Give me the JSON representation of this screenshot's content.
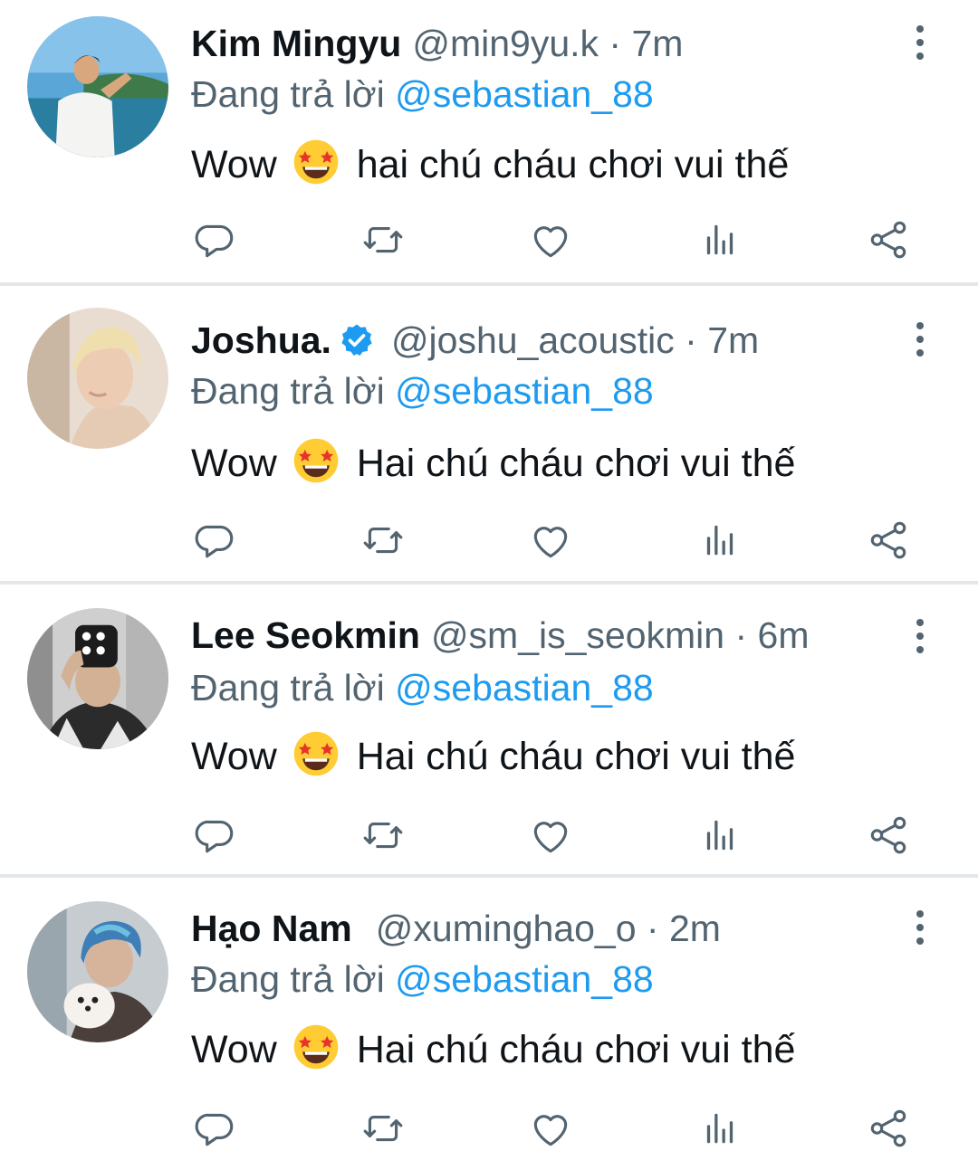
{
  "reply_prefix": "Đang trả lời",
  "colors": {
    "accent": "#1d9bf0",
    "muted": "#536471",
    "divider": "#e4e7ea"
  },
  "tweets": [
    {
      "name": "Kim Mingyu",
      "verified": false,
      "handle": "@min9yu.k · 7m",
      "reply_to": "@sebastian_88",
      "text_before": "Wow",
      "text_after": "hai chú cháu chơi vui thế"
    },
    {
      "name": "Joshua.",
      "verified": true,
      "handle": "@joshu_acoustic · 7m",
      "reply_to": "@sebastian_88",
      "text_before": "Wow",
      "text_after": "Hai chú cháu chơi vui thế"
    },
    {
      "name": "Lee Seokmin",
      "verified": false,
      "handle": "@sm_is_seokmin · 6m",
      "reply_to": "@sebastian_88",
      "text_before": "Wow",
      "text_after": "Hai chú cháu chơi vui thế"
    },
    {
      "name": "Hạo Nam",
      "verified": false,
      "handle": "@xuminghao_o · 2m",
      "reply_to": "@sebastian_88",
      "text_before": "Wow",
      "text_after": "Hai chú cháu chơi vui thế"
    }
  ],
  "emoji_icon": "star-struck-emoji-icon",
  "action_icons": [
    "reply-icon",
    "retweet-icon",
    "like-icon",
    "views-icon",
    "share-icon"
  ]
}
